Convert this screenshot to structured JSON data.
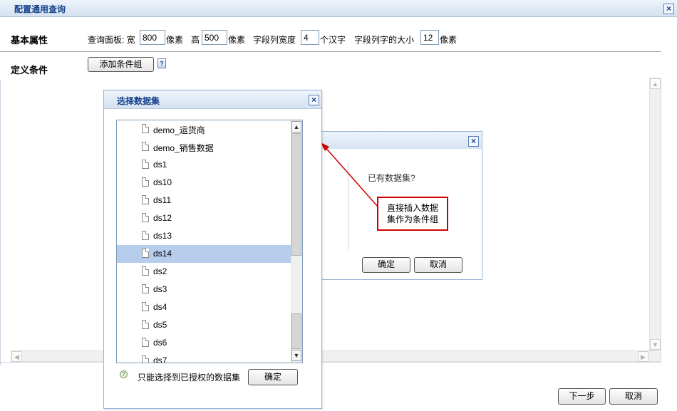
{
  "window": {
    "title": "配置通用查询"
  },
  "basic": {
    "label": "基本属性",
    "panel_width_prefix": "查询面板: 宽",
    "panel_width": "800",
    "px1": "像素",
    "height_label": "高",
    "panel_height": "500",
    "px2": "像素",
    "col_width_label": "字段列宽度",
    "col_width": "4",
    "col_width_unit": "个汉字",
    "font_size_label": "字段列字的大小",
    "font_size": "12",
    "px3": "像素"
  },
  "conditions": {
    "label": "定义条件",
    "add_group_button": "添加条件组"
  },
  "confirm_dialog": {
    "message": "已有数据集?",
    "ok": "确定",
    "cancel": "取消"
  },
  "annotation": {
    "line1": "直接插入数据",
    "line2": "集作为条件组"
  },
  "dataset_dialog": {
    "title": "选择数据集",
    "items": [
      "demo_运货商",
      "demo_销售数据",
      "ds1",
      "ds10",
      "ds11",
      "ds12",
      "ds13",
      "ds14",
      "ds2",
      "ds3",
      "ds4",
      "ds5",
      "ds6",
      "ds7"
    ],
    "selected": "ds14",
    "hint": "只能选择到已授权的数据集",
    "ok": "确定"
  },
  "footer": {
    "next": "下一步",
    "cancel": "取消"
  },
  "colors": {
    "title_text": "#15428b",
    "selection": "#b6cdec",
    "annotation_border": "#d00000"
  }
}
